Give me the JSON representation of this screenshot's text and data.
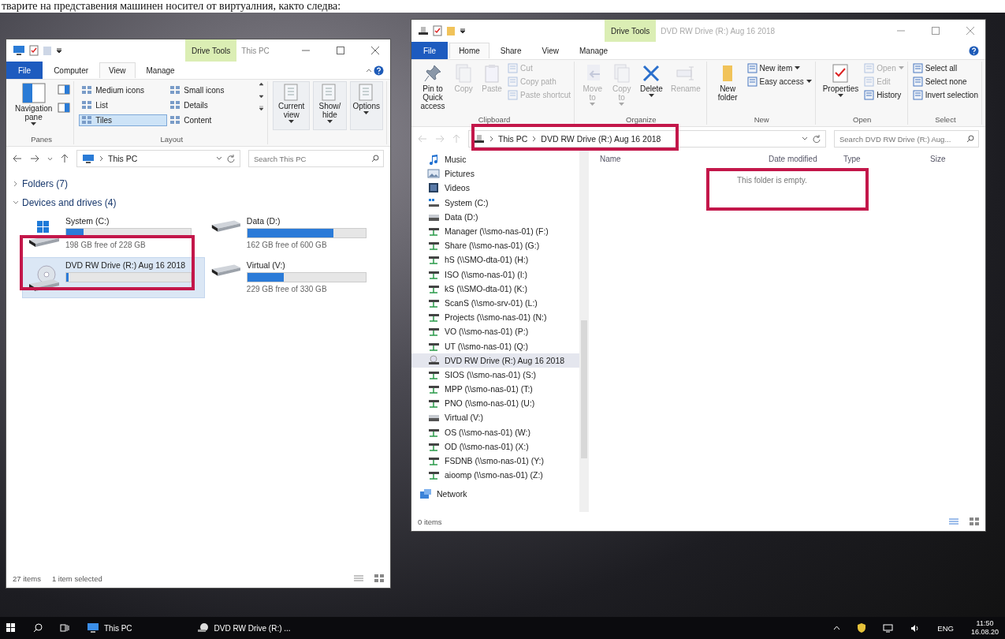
{
  "caption": "тварите на представения машинен носител от виртуалния, както следва:",
  "left_window": {
    "context_tab": "Drive Tools",
    "title": "This PC",
    "tabs": [
      {
        "label": "File",
        "kind": "file",
        "selected": false
      },
      {
        "label": "Computer",
        "kind": "tab",
        "selected": false
      },
      {
        "label": "View",
        "kind": "tab",
        "selected": true
      },
      {
        "label": "Manage",
        "kind": "tab",
        "selected": false
      }
    ],
    "panes_group": {
      "label": "Panes",
      "button": "Navigation pane"
    },
    "layout_group": {
      "label": "Layout",
      "options": [
        {
          "label": "Medium icons",
          "selected": false
        },
        {
          "label": "Small icons",
          "selected": false
        },
        {
          "label": "List",
          "selected": false
        },
        {
          "label": "Details",
          "selected": false
        },
        {
          "label": "Tiles",
          "selected": true
        },
        {
          "label": "Content",
          "selected": false
        }
      ]
    },
    "view_buttons": [
      "Current view",
      "Show/ hide",
      "Options"
    ],
    "address": [
      "This PC"
    ],
    "search": {
      "placeholder": "Search This PC"
    },
    "sections": [
      {
        "label": "Folders (7)",
        "expanded": false
      },
      {
        "label": "Devices and drives (4)",
        "expanded": true
      }
    ],
    "drives": [
      {
        "name": "System (C:)",
        "kind": "system",
        "level": 0.14,
        "free": "198 GB free of 228 GB",
        "selected": false
      },
      {
        "name": "Data (D:)",
        "kind": "hdd",
        "level": 0.73,
        "free": "162 GB free of 600 GB",
        "selected": false
      },
      {
        "name": "DVD RW Drive (R:) Aug 16 2018",
        "kind": "dvd",
        "level": 0.02,
        "selected": true
      },
      {
        "name": "Virtual (V:)",
        "kind": "hdd",
        "level": 0.31,
        "free": "229 GB free of 330 GB",
        "selected": false
      }
    ],
    "status": [
      "27 items",
      "1 item selected"
    ]
  },
  "right_window": {
    "context_tab": "Drive Tools",
    "title": "DVD RW Drive (R:) Aug 16 2018",
    "tabs": [
      {
        "label": "File",
        "kind": "file",
        "selected": false
      },
      {
        "label": "Home",
        "kind": "tab",
        "selected": true
      },
      {
        "label": "Share",
        "kind": "tab",
        "selected": false
      },
      {
        "label": "View",
        "kind": "tab",
        "selected": false
      },
      {
        "label": "Manage",
        "kind": "tab",
        "selected": false
      }
    ],
    "groups": [
      {
        "label": "Clipboard",
        "items": [
          {
            "kind": "large",
            "label": "Pin to Quick access",
            "disabled": false,
            "dropdown": false
          },
          {
            "kind": "large",
            "label": "Copy",
            "disabled": true,
            "dropdown": false
          },
          {
            "kind": "large",
            "label": "Paste",
            "disabled": true,
            "dropdown": false
          },
          {
            "kind": "stack",
            "items": [
              {
                "label": "Cut",
                "disabled": true,
                "dropdown": false
              },
              {
                "label": "Copy path",
                "disabled": true,
                "dropdown": false
              },
              {
                "label": "Paste shortcut",
                "disabled": true,
                "dropdown": false
              }
            ]
          }
        ]
      },
      {
        "label": "Organize",
        "items": [
          {
            "kind": "large",
            "label": "Move to",
            "disabled": true,
            "dropdown": true
          },
          {
            "kind": "large",
            "label": "Copy to",
            "disabled": true,
            "dropdown": true
          },
          {
            "kind": "large",
            "label": "Delete",
            "disabled": false,
            "dropdown": true
          },
          {
            "kind": "large",
            "label": "Rename",
            "disabled": true,
            "dropdown": false
          }
        ]
      },
      {
        "label": "New",
        "items": [
          {
            "kind": "large",
            "label": "New folder",
            "disabled": false,
            "dropdown": false
          },
          {
            "kind": "stack",
            "items": [
              {
                "label": "New item",
                "disabled": false,
                "dropdown": true
              },
              {
                "label": "Easy access",
                "disabled": false,
                "dropdown": true
              }
            ]
          }
        ]
      },
      {
        "label": "Open",
        "items": [
          {
            "kind": "large",
            "label": "Properties",
            "disabled": false,
            "dropdown": true
          },
          {
            "kind": "stack",
            "items": [
              {
                "label": "Open",
                "disabled": true,
                "dropdown": true
              },
              {
                "label": "Edit",
                "disabled": true,
                "dropdown": false
              },
              {
                "label": "History",
                "disabled": false,
                "dropdown": false
              }
            ]
          }
        ]
      },
      {
        "label": "Select",
        "items": [
          {
            "kind": "stack",
            "items": [
              {
                "label": "Select all",
                "disabled": false,
                "dropdown": false
              },
              {
                "label": "Select none",
                "disabled": false,
                "dropdown": false
              },
              {
                "label": "Invert selection",
                "disabled": false,
                "dropdown": false
              }
            ]
          }
        ]
      }
    ],
    "address": [
      "This PC",
      "DVD RW Drive (R:) Aug 16 2018"
    ],
    "search": {
      "placeholder": "Search DVD RW Drive (R:) Aug..."
    },
    "nav": [
      {
        "label": "Music",
        "kind": "music",
        "selected": false
      },
      {
        "label": "Pictures",
        "kind": "pictures",
        "selected": false
      },
      {
        "label": "Videos",
        "kind": "videos",
        "selected": false
      },
      {
        "label": "System (C:)",
        "kind": "system",
        "selected": false
      },
      {
        "label": "Data (D:)",
        "kind": "drive",
        "selected": false
      },
      {
        "label": "Manager (\\\\smo-nas-01) (F:)",
        "kind": "network",
        "selected": false
      },
      {
        "label": "Share (\\\\smo-nas-01) (G:)",
        "kind": "network",
        "selected": false
      },
      {
        "label": "hS (\\\\SMO-dta-01) (H:)",
        "kind": "network",
        "selected": false
      },
      {
        "label": "ISO (\\\\smo-nas-01) (I:)",
        "kind": "network",
        "selected": false
      },
      {
        "label": "kS (\\\\SMO-dta-01) (K:)",
        "kind": "network",
        "selected": false
      },
      {
        "label": "ScanS (\\\\smo-srv-01) (L:)",
        "kind": "network",
        "selected": false
      },
      {
        "label": "Projects (\\\\smo-nas-01) (N:)",
        "kind": "network",
        "selected": false
      },
      {
        "label": "VO (\\\\smo-nas-01) (P:)",
        "kind": "network",
        "selected": false
      },
      {
        "label": "UT (\\\\smo-nas-01) (Q:)",
        "kind": "network",
        "selected": false
      },
      {
        "label": "DVD RW Drive (R:) Aug 16 2018",
        "kind": "dvd",
        "selected": true
      },
      {
        "label": "SIOS (\\\\smo-nas-01) (S:)",
        "kind": "network",
        "selected": false
      },
      {
        "label": "MPP (\\\\smo-nas-01) (T:)",
        "kind": "network",
        "selected": false
      },
      {
        "label": "PNO (\\\\smo-nas-01) (U:)",
        "kind": "network",
        "selected": false
      },
      {
        "label": "Virtual (V:)",
        "kind": "drive",
        "selected": false
      },
      {
        "label": "OS (\\\\smo-nas-01) (W:)",
        "kind": "network",
        "selected": false
      },
      {
        "label": "OD (\\\\smo-nas-01) (X:)",
        "kind": "network",
        "selected": false
      },
      {
        "label": "FSDNB (\\\\smo-nas-01) (Y:)",
        "kind": "network",
        "selected": false
      },
      {
        "label": "aioomp (\\\\smo-nas-01) (Z:)",
        "kind": "network",
        "selected": false
      },
      {
        "label": "Network",
        "kind": "network-root",
        "selected": false
      }
    ],
    "columns": [
      "Name",
      "Date modified",
      "Type",
      "Size"
    ],
    "empty_message": "This folder is empty.",
    "status": "0 items"
  },
  "taskbar": {
    "items": [
      {
        "label": "This PC",
        "kind": "pc"
      },
      {
        "label": "DVD RW Drive (R:) ...",
        "kind": "dvd"
      }
    ],
    "language": "ENG",
    "time": "11:50",
    "date": "16.08.20"
  }
}
